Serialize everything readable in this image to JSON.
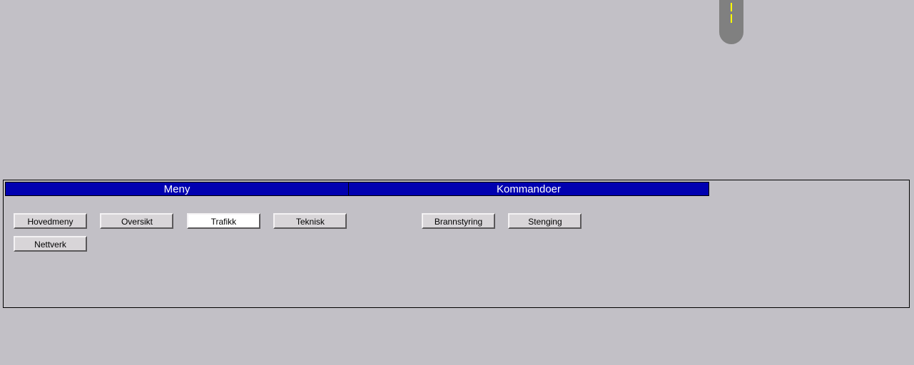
{
  "indicator": {
    "color": "#808080",
    "light_color": "#ffff00"
  },
  "panel": {
    "headers": {
      "menu": "Meny",
      "commands": "Kommandoer"
    },
    "menu_buttons": {
      "row1": [
        {
          "label": "Hovedmeny",
          "active": false
        },
        {
          "label": "Oversikt",
          "active": false
        },
        {
          "label": "Trafikk",
          "active": true
        },
        {
          "label": "Teknisk",
          "active": false
        }
      ],
      "row2": [
        {
          "label": "Nettverk",
          "active": false
        }
      ]
    },
    "command_buttons": [
      {
        "label": "Brannstyring"
      },
      {
        "label": "Stenging"
      }
    ]
  },
  "colors": {
    "background": "#c2c0c6",
    "header_bg": "#0000b0",
    "header_text": "#ffffff",
    "button_bg": "#d8d5d8",
    "button_active_bg": "#ffffff"
  }
}
